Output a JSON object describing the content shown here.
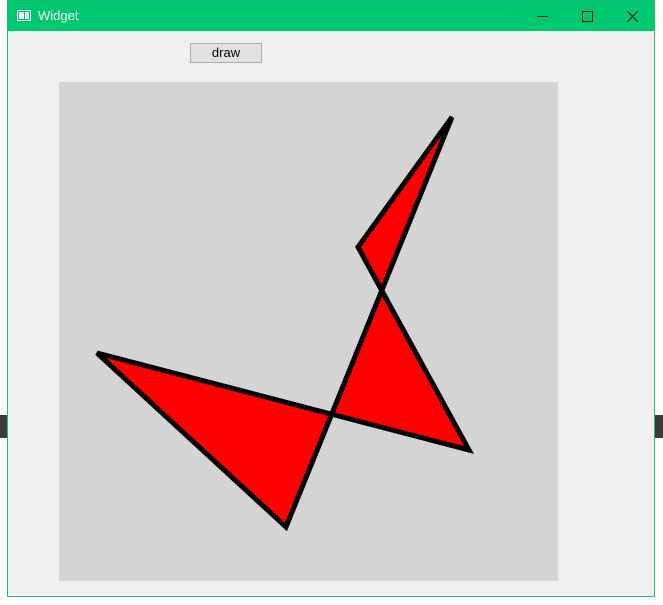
{
  "window": {
    "title": "Widget",
    "icon": "window-app-icon",
    "controls": {
      "minimize_icon": "minimize-icon",
      "maximize_icon": "maximize-icon",
      "close_icon": "close-icon"
    },
    "titlebar_color": "#00c86e"
  },
  "toolbar": {
    "draw_label": "draw"
  },
  "canvas": {
    "background": "#d4d4d4",
    "shape_fill": "#ff0000",
    "shape_stroke": "#000000"
  }
}
